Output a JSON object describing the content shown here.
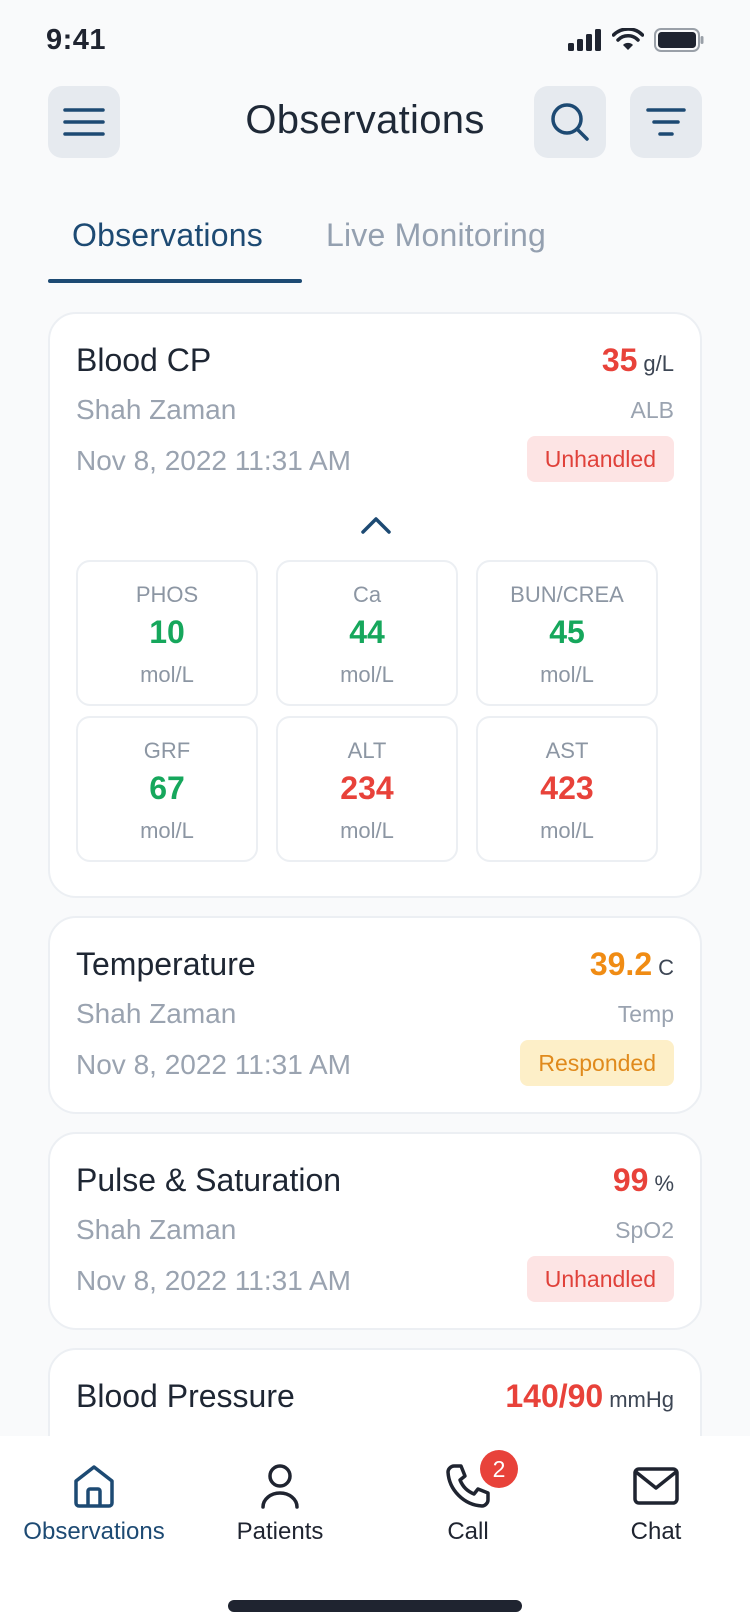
{
  "status_bar": {
    "time": "9:41"
  },
  "header": {
    "title": "Observations"
  },
  "tabs": [
    {
      "label": "Observations"
    },
    {
      "label": "Live Monitoring"
    }
  ],
  "cards": [
    {
      "title": "Blood CP",
      "value": "35",
      "unit": "g/L",
      "patient": "Shah Zaman",
      "code": "ALB",
      "datetime": "Nov 8, 2022 11:31 AM",
      "status": "Unhandled",
      "metrics": [
        {
          "label": "PHOS",
          "value": "10",
          "unit": "mol/L"
        },
        {
          "label": "Ca",
          "value": "44",
          "unit": "mol/L"
        },
        {
          "label": "BUN/CREA",
          "value": "45",
          "unit": "mol/L"
        },
        {
          "label": "GRF",
          "value": "67",
          "unit": "mol/L"
        },
        {
          "label": "ALT",
          "value": "234",
          "unit": "mol/L"
        },
        {
          "label": "AST",
          "value": "423",
          "unit": "mol/L"
        }
      ]
    },
    {
      "title": "Temperature",
      "value": "39.2",
      "unit": "C",
      "patient": "Shah Zaman",
      "code": "Temp",
      "datetime": "Nov 8, 2022 11:31 AM",
      "status": "Responded"
    },
    {
      "title": "Pulse & Saturation",
      "value": "99",
      "unit": "%",
      "patient": "Shah Zaman",
      "code": "SpO2",
      "datetime": "Nov 8, 2022 11:31 AM",
      "status": "Unhandled"
    },
    {
      "title": "Blood Pressure",
      "value": "140/90",
      "unit": "mmHg"
    }
  ],
  "bottom_nav": [
    {
      "label": "Observations",
      "icon": "home-icon"
    },
    {
      "label": "Patients",
      "icon": "user-icon"
    },
    {
      "label": "Call",
      "icon": "phone-icon",
      "badge": "2"
    },
    {
      "label": "Chat",
      "icon": "mail-icon"
    }
  ],
  "colors": {
    "primary": "#1d4a73",
    "critical": "#e8423a",
    "warning": "#f08c14",
    "normal": "#16a75c"
  }
}
